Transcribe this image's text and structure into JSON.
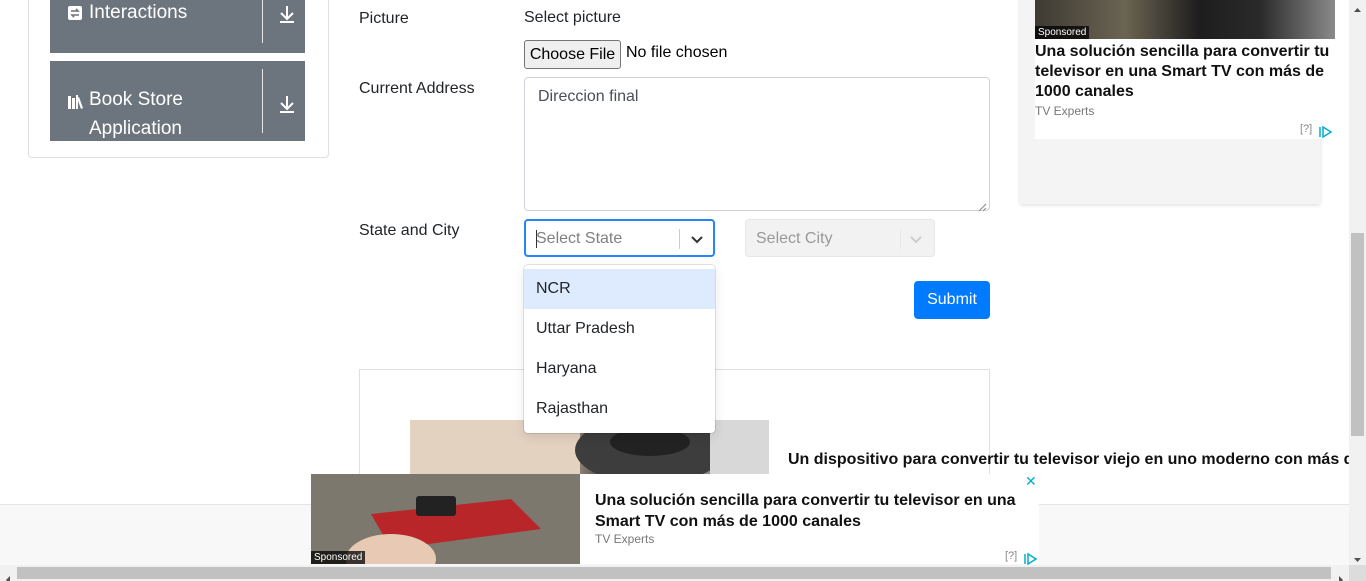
{
  "sidebar": {
    "groups": [
      {
        "label": "Interactions",
        "icon": "interactions-icon"
      },
      {
        "label": "Book Store\nApplication",
        "label_line1": "Book Store",
        "label_line2": "Application",
        "icon": "books-icon"
      }
    ]
  },
  "form": {
    "picture_label": "Picture",
    "select_picture_text": "Select picture",
    "choose_file_label": "Choose File",
    "no_file_text": "No file chosen",
    "address_label": "Current Address",
    "address_value": "Direccion final",
    "state_city_label": "State and City",
    "state_placeholder": "Select State",
    "city_placeholder": "Select City",
    "state_options": [
      "NCR",
      "Uttar Pradesh",
      "Haryana",
      "Rajasthan"
    ],
    "focused_option": "NCR",
    "submit_label": "Submit"
  },
  "right_ad": {
    "sponsored": "Sponsored",
    "title": "Una solución sencilla para convertir tu televisor en una Smart TV con más de 1000 canales",
    "source": "TV Experts",
    "info": "[?]"
  },
  "mid_ad": {
    "text": "Un dispositivo para convertir tu televisor viejo en uno moderno con más de"
  },
  "bottom_ad": {
    "sponsored": "Sponsored",
    "title": "Una solución sencilla para convertir tu televisor en una Smart TV con más de 1000 canales",
    "source": "TV Experts",
    "info": "[?]",
    "close": "✕"
  },
  "colors": {
    "sidebar_header": "#6c757d",
    "primary": "#007bff",
    "select_focus": "#2684ff",
    "option_focus": "#deebff",
    "adchoices": "#00aecd"
  }
}
